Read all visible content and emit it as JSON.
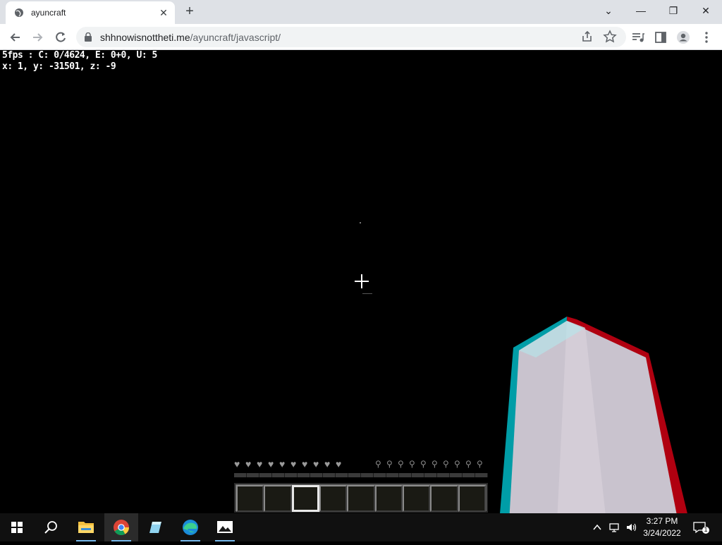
{
  "browser": {
    "tab_title": "ayuncraft",
    "tab_close": "✕",
    "new_tab": "+",
    "window_controls": {
      "dropdown": "⌄",
      "minimize": "—",
      "restore": "❐",
      "close": "✕"
    },
    "url_host": "shhnowisnottheti.me",
    "url_path": "/ayuncraft/javascript/",
    "toolbar_icons": [
      "back-icon",
      "forward-icon",
      "reload-icon",
      "share-icon",
      "bookmark-star-icon",
      "media-icon",
      "side-panel-icon",
      "profile-icon",
      "menu-icon"
    ]
  },
  "game": {
    "debug_line1": "5fps : C: 0/4624, E: 0+0, U: 5",
    "debug_line2": "x: 1, y: -31501, z: -9",
    "health_hearts": 10,
    "hunger": 10,
    "hotbar_slots": 9,
    "selected_slot": 3
  },
  "taskbar": {
    "apps": [
      "start-icon",
      "search-icon",
      "file-explorer-icon",
      "chrome-icon",
      "app-icon",
      "edge-icon",
      "photos-icon"
    ],
    "clock_time": "3:27 PM",
    "clock_date": "3/24/2022",
    "notification_count": "1"
  },
  "colors": {
    "tabbar": "#dee1e6",
    "game_bg": "#000000",
    "hand_left": "#00b7c3",
    "hand_right": "#c00010",
    "taskbar": "#101010"
  }
}
